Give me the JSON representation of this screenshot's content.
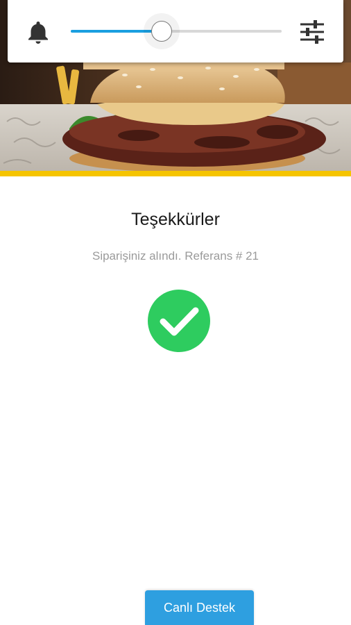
{
  "confirmation": {
    "title": "Teşekkürler",
    "message": "Siparişiniz alındı. Referans # 21"
  },
  "volume_popup": {
    "level": 0.43,
    "left_icon": "bell-icon",
    "right_icon": "sliders-icon",
    "accent_color": "#1a9fe0"
  },
  "support": {
    "button_label": "Canlı Destek",
    "color": "#2e9fe0"
  },
  "status": {
    "icon": "checkmark-circle-icon",
    "color": "#2ecc5f"
  },
  "hero": {
    "image": "burger-photo",
    "accent_stripe_color": "#f5c400"
  }
}
